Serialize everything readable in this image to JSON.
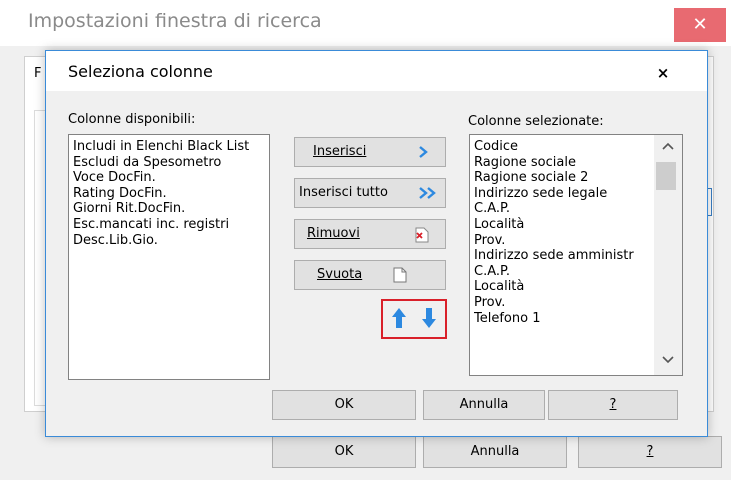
{
  "parent_window": {
    "title": "Impostazioni finestra di ricerca",
    "close_glyph": "✕",
    "tab_letter": "F",
    "ok_label": "OK",
    "annulla_label": "Annulla",
    "help_label": "?"
  },
  "dialog": {
    "title": "Seleziona colonne",
    "close_glyph": "×",
    "available_label": "Colonne disponibili:",
    "selected_label": "Colonne selezionate:",
    "available_columns": [
      "Includi in Elenchi Black List",
      "Escludi da Spesometro",
      "Voce DocFin.",
      "Rating DocFin.",
      "Giorni Rit.DocFin.",
      "Esc.mancati inc. registri",
      "Desc.Lib.Gio."
    ],
    "selected_columns": [
      "Codice",
      "Ragione sociale",
      "Ragione sociale 2",
      "Indirizzo sede legale",
      "C.A.P.",
      "Località",
      "Prov.",
      "Indirizzo sede amministr",
      "C.A.P.",
      "Località",
      "Prov.",
      "Telefono 1"
    ],
    "buttons": {
      "inserisci": "Inserisci",
      "inserisci_icon": "chevron-right-icon",
      "inserisci_tutto": "Inserisci tutto",
      "inserisci_tutto_icon": "double-chevron-right-icon",
      "rimuovi": "Rimuovi",
      "rimuovi_icon": "delete-document-icon",
      "svuota": "Svuota",
      "svuota_icon": "blank-document-icon",
      "move_up_icon": "arrow-up-icon",
      "move_down_icon": "arrow-down-icon",
      "ok": "OK",
      "annulla": "Annulla",
      "help": "?"
    },
    "scroll": {
      "up_glyph": "^",
      "down_glyph": "v"
    }
  },
  "colors": {
    "accent_blue": "#3a8bd8",
    "close_red": "#e86a71",
    "highlight_red": "#d9202a"
  }
}
